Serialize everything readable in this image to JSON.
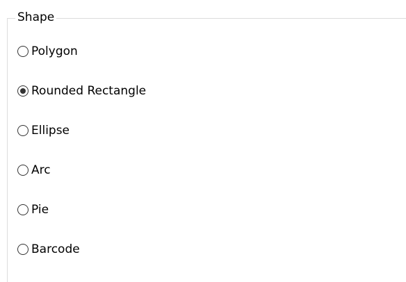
{
  "group": {
    "title": "Shape"
  },
  "options": [
    {
      "label": "Polygon",
      "checked": false
    },
    {
      "label": "Rounded Rectangle",
      "checked": true
    },
    {
      "label": "Ellipse",
      "checked": false
    },
    {
      "label": "Arc",
      "checked": false
    },
    {
      "label": "Pie",
      "checked": false
    },
    {
      "label": "Barcode",
      "checked": false
    }
  ]
}
